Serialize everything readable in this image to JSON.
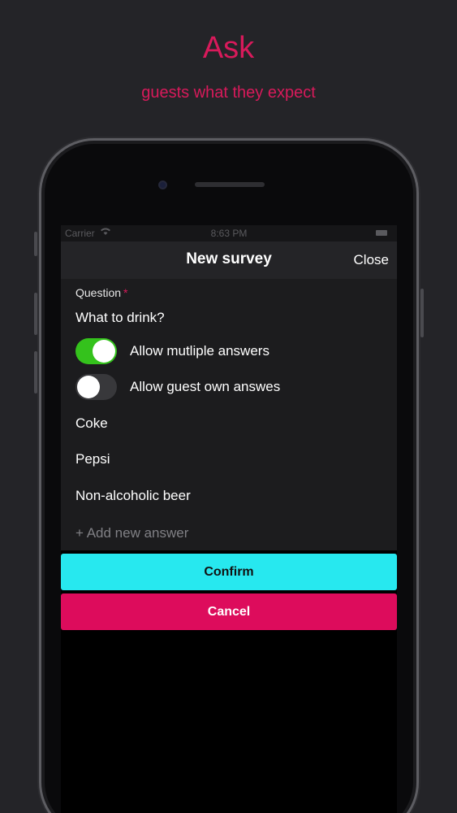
{
  "promo": {
    "headline": "Ask",
    "subline": "guests what they expect"
  },
  "status_bar": {
    "carrier": "Carrier",
    "time": "8:63 PM"
  },
  "nav": {
    "title": "New survey",
    "close_label": "Close"
  },
  "form": {
    "question_label": "Question",
    "required_marker": "*",
    "question_value": "What to drink?",
    "toggles": [
      {
        "label": "Allow mutliple answers",
        "on": true
      },
      {
        "label": "Allow guest own answes",
        "on": false
      }
    ],
    "answers": [
      "Coke",
      "Pepsi",
      "Non-alcoholic beer"
    ],
    "add_answer_label": "+ Add new answer"
  },
  "actions": {
    "confirm_label": "Confirm",
    "cancel_label": "Cancel"
  },
  "colors": {
    "accent": "#d81a5b",
    "confirm": "#27e8ef",
    "cancel": "#dd0c5c",
    "toggle_on": "#34c21c"
  },
  "icons": [
    "wifi-icon",
    "battery-icon"
  ]
}
